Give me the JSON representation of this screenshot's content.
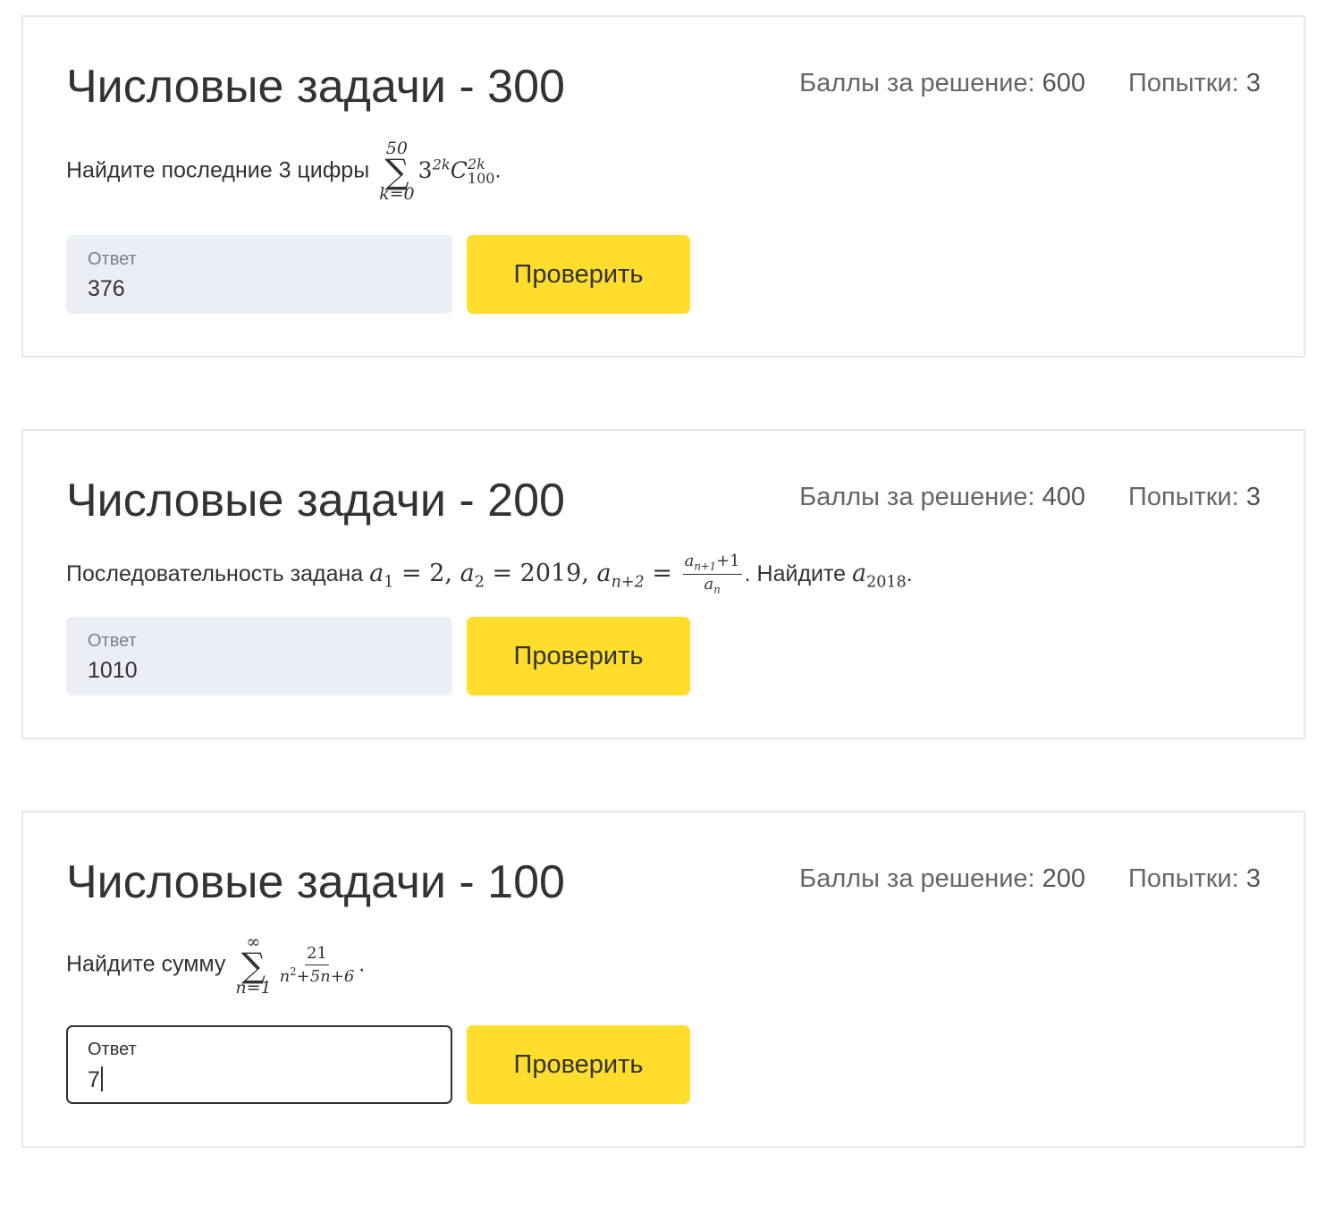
{
  "tasks": [
    {
      "title": "Числовые задачи - 300",
      "points_label": "Баллы за решение:",
      "points": "600",
      "attempts_label": "Попытки:",
      "attempts": "3",
      "statement_prefix": "Найдите последние 3 цифры",
      "math": {
        "sum_upper": "50",
        "sum_lower": "k=0",
        "base": "3",
        "exp": "2k",
        "c": "C",
        "c_sup": "2k",
        "c_sub": "100"
      },
      "statement_suffix": ".",
      "answer_label": "Ответ",
      "answer_value": "376",
      "button": "Проверить"
    },
    {
      "title": "Числовые задачи - 200",
      "points_label": "Баллы за решение:",
      "points": "400",
      "attempts_label": "Попытки:",
      "attempts": "3",
      "statement_prefix": "Последовательность задана",
      "statement_mid": ". Найдите",
      "statement_suffix": ".",
      "answer_label": "Ответ",
      "answer_value": "1010",
      "button": "Проверить"
    },
    {
      "title": "Числовые задачи - 100",
      "points_label": "Баллы за решение:",
      "points": "200",
      "attempts_label": "Попытки:",
      "attempts": "3",
      "statement_prefix": "Найдите сумму",
      "math": {
        "sum_upper": "∞",
        "sum_lower": "n=1",
        "num": "21",
        "den_suffix": "+5n+6"
      },
      "statement_suffix": ".",
      "answer_label": "Ответ",
      "answer_value": "7",
      "button": "Проверить"
    }
  ]
}
